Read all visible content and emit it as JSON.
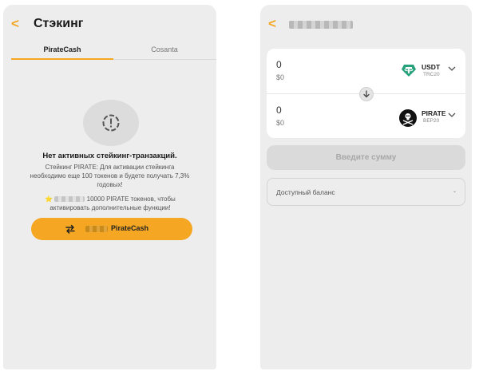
{
  "staking": {
    "back_glyph": "<",
    "title": "Стэкинг",
    "tabs": [
      {
        "label": "PirateCash",
        "active": true
      },
      {
        "label": "Cosanta",
        "active": false
      }
    ],
    "empty_icon": "warning-icon",
    "empty_title": "Нет активных стейкинг-транзакций.",
    "empty_description": "Стейкинг PIRATE: Для активации стейкинга необходимо еще 100 токенов и будете получать 7,3% годовых!",
    "note": {
      "star": "⭐",
      "text": "10000 PIRATE токенов, чтобы активировать дополнительные функции!"
    },
    "cta": {
      "label": "PirateCash",
      "icon": "swap-arrows-icon"
    },
    "accent_color": "#f5a623"
  },
  "swap": {
    "back_glyph": "<",
    "from": {
      "amount": "0",
      "fiat": "$0",
      "token": "USDT",
      "network": "TRC20",
      "logo_color": "#26a17b"
    },
    "to": {
      "amount": "0",
      "fiat": "$0",
      "token": "PIRATE",
      "network": "BEP20",
      "logo_color": "#111111"
    },
    "submit_label": "Введите сумму",
    "balance_label": "Доступный баланс",
    "balance_value": "-"
  }
}
